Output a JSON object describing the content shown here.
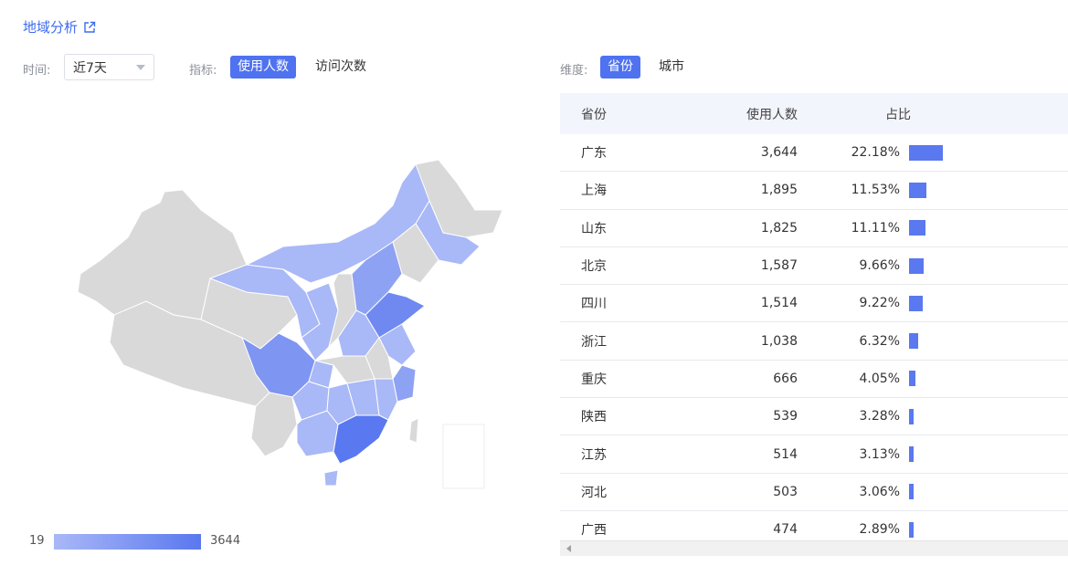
{
  "header": {
    "title": "地域分析"
  },
  "filters": {
    "time_label": "时间:",
    "time_value": "近7天",
    "metric_label": "指标:",
    "metric_options": [
      "使用人数",
      "访问次数"
    ],
    "dimension_label": "维度:",
    "dimension_options": [
      "省份",
      "城市"
    ]
  },
  "legend": {
    "min": "19",
    "max": "3644",
    "color_low": "#a9b8f7",
    "color_high": "#5a78ef"
  },
  "table": {
    "headers": [
      "省份",
      "使用人数",
      "占比"
    ],
    "rows": [
      {
        "province": "广东",
        "users": "3,644",
        "share": "22.18%",
        "pct": 22.18
      },
      {
        "province": "上海",
        "users": "1,895",
        "share": "11.53%",
        "pct": 11.53
      },
      {
        "province": "山东",
        "users": "1,825",
        "share": "11.11%",
        "pct": 11.11
      },
      {
        "province": "北京",
        "users": "1,587",
        "share": "9.66%",
        "pct": 9.66
      },
      {
        "province": "四川",
        "users": "1,514",
        "share": "9.22%",
        "pct": 9.22
      },
      {
        "province": "浙江",
        "users": "1,038",
        "share": "6.32%",
        "pct": 6.32
      },
      {
        "province": "重庆",
        "users": "666",
        "share": "4.05%",
        "pct": 4.05
      },
      {
        "province": "陕西",
        "users": "539",
        "share": "3.28%",
        "pct": 3.28
      },
      {
        "province": "江苏",
        "users": "514",
        "share": "3.13%",
        "pct": 3.13
      },
      {
        "province": "河北",
        "users": "503",
        "share": "3.06%",
        "pct": 3.06
      },
      {
        "province": "广西",
        "users": "474",
        "share": "2.89%",
        "pct": 2.89
      }
    ]
  },
  "colors": {
    "accent": "#4f72f0",
    "map_gray": "#d9d9d9",
    "map_light": "#a9b8f7",
    "map_mid": "#8ea2f4",
    "map_dark": "#5a78ef"
  }
}
